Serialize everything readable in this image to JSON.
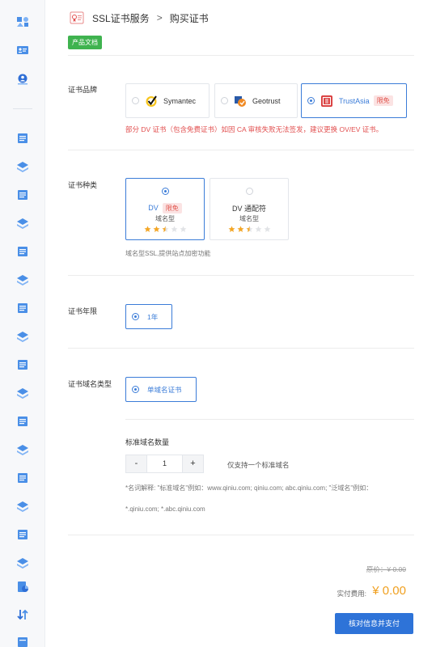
{
  "header": {
    "breadcrumb_root": "SSL证书服务",
    "breadcrumb_sep": ">",
    "breadcrumb_current": "购买证书",
    "doc_badge": "产品文档"
  },
  "brand": {
    "label": "证书品牌",
    "options": [
      {
        "name": "Symantec",
        "icon": "symantec-logo",
        "selected": false
      },
      {
        "name": "Geotrust",
        "icon": "geotrust-logo",
        "selected": false
      },
      {
        "name": "TrustAsia",
        "icon": "trustasia-logo",
        "selected": true,
        "tag": "限免"
      }
    ],
    "warning": "部分 DV 证书（包含免费证书）如因 CA 审核失败无法签发，建议更换 OV/EV 证书。"
  },
  "cert_type": {
    "label": "证书种类",
    "options": [
      {
        "title": "DV",
        "tag": "限免",
        "subtitle": "域名型",
        "rating": 2.5,
        "max_rating": 5,
        "selected": true
      },
      {
        "title": "DV 通配符",
        "subtitle": "域名型",
        "rating": 2.5,
        "max_rating": 5,
        "selected": false
      }
    ],
    "hint": "域名型SSL,提供站点加密功能"
  },
  "period": {
    "label": "证书年限",
    "option": "1年"
  },
  "domain_type": {
    "label": "证书域名类型",
    "option": "单域名证书"
  },
  "quantity": {
    "title": "标准域名数量",
    "minus": "-",
    "value": "1",
    "plus": "+",
    "note": "仅支持一个标准域名",
    "explain_line1": "*名词解释: \"标准域名\"例如：www.qiniu.com; qiniu.com; abc.qiniu.com; \"泛域名\"例如：",
    "explain_line2": "*.qiniu.com; *.abc.qiniu.com"
  },
  "pricing": {
    "original_label": "原价：",
    "original_value": "¥ 0.00",
    "actual_label": "实付费用:",
    "actual_value": "¥ 0.00"
  },
  "pay_button": "核对信息并支付",
  "colors": {
    "accent": "#2e73d8",
    "success": "#3fb34f",
    "warning_text": "#e25050",
    "price": "#f0a020",
    "star": "#f5a623"
  }
}
